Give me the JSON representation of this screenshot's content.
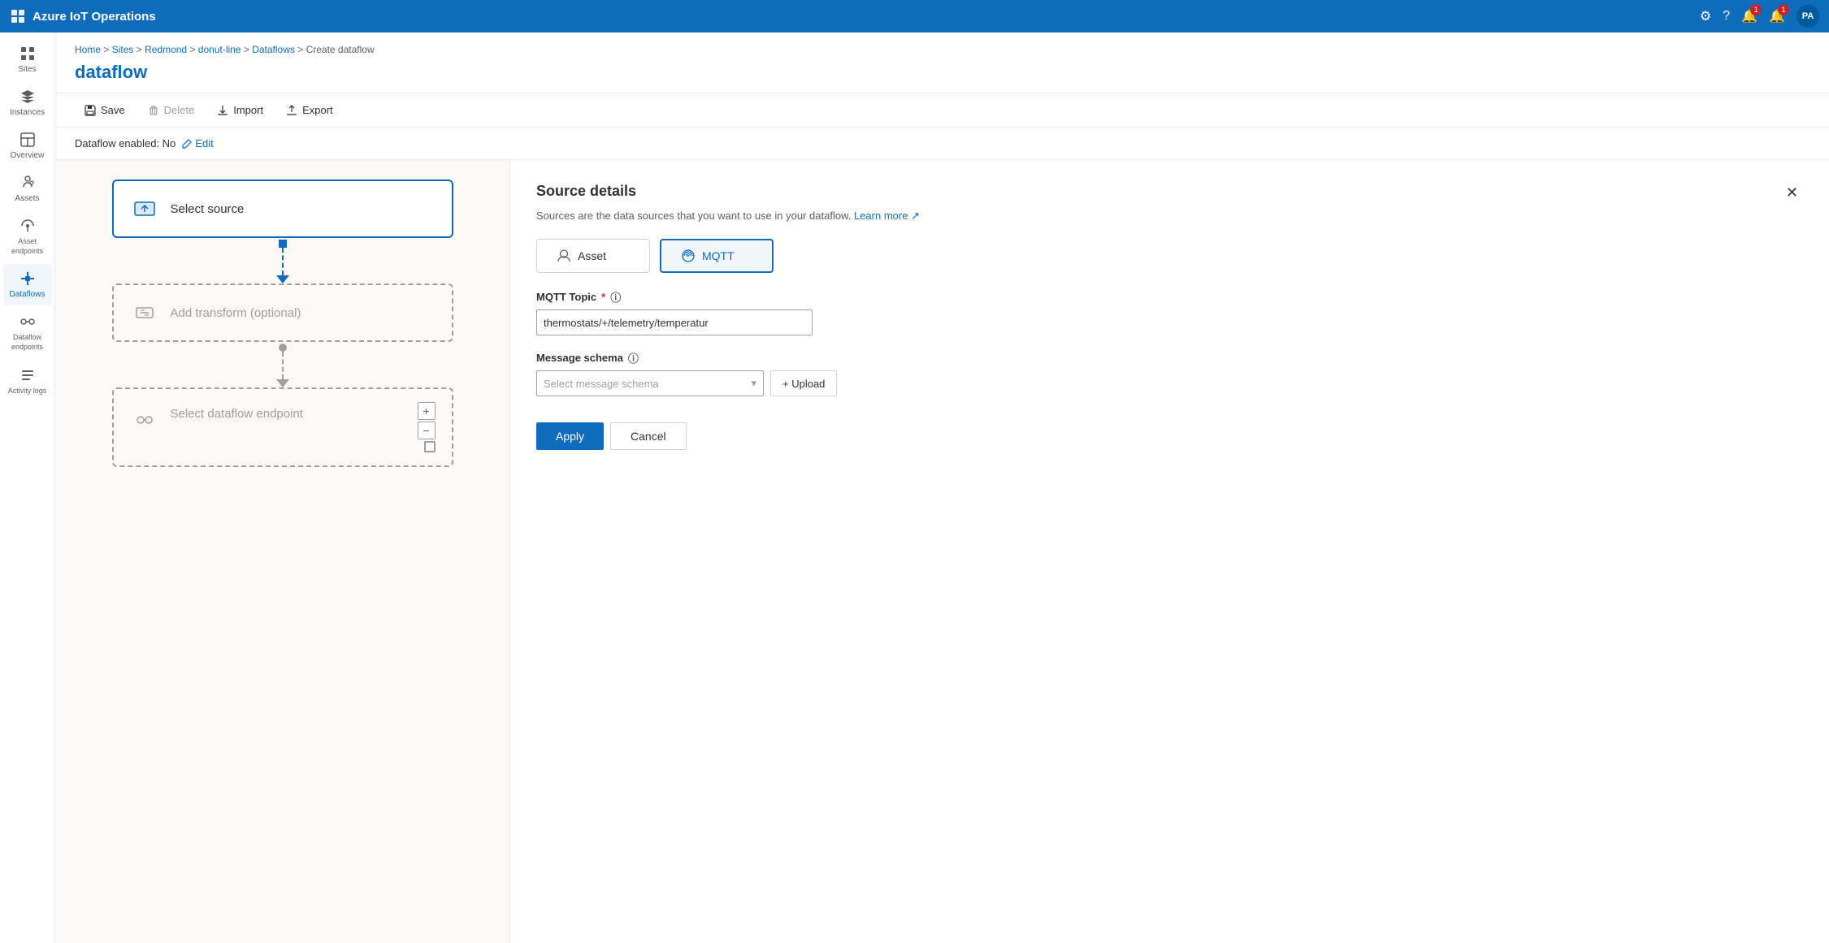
{
  "app": {
    "title": "Azure IoT Operations"
  },
  "topbar": {
    "title": "Azure IoT Operations",
    "user_initials": "PA"
  },
  "breadcrumb": {
    "items": [
      "Home",
      "Sites",
      "Redmond",
      "donut-line",
      "Dataflows",
      "Create dataflow"
    ]
  },
  "page": {
    "title": "dataflow"
  },
  "toolbar": {
    "save": "Save",
    "delete": "Delete",
    "import": "Import",
    "export": "Export"
  },
  "status": {
    "label": "Dataflow enabled: No",
    "edit": "Edit"
  },
  "canvas": {
    "select_source_label": "Select source",
    "add_transform_label": "Add transform (optional)",
    "select_endpoint_label": "Select dataflow endpoint"
  },
  "details_panel": {
    "title": "Source details",
    "description": "Sources are the data sources that you want to use in your dataflow.",
    "learn_more": "Learn more",
    "asset_btn": "Asset",
    "mqtt_btn": "MQTT",
    "mqtt_topic_label": "MQTT Topic",
    "mqtt_topic_required": "*",
    "mqtt_topic_value": "thermostats/+/telemetry/temperatur",
    "message_schema_label": "Message schema",
    "message_schema_placeholder": "Select message schema",
    "upload_btn": "+ Upload",
    "apply_btn": "Apply",
    "cancel_btn": "Cancel"
  },
  "sidebar": {
    "items": [
      {
        "label": "Sites",
        "icon": "grid"
      },
      {
        "label": "Instances",
        "icon": "layers"
      },
      {
        "label": "Overview",
        "icon": "view"
      },
      {
        "label": "Assets",
        "icon": "asset"
      },
      {
        "label": "Asset endpoints",
        "icon": "endpoint"
      },
      {
        "label": "Dataflows",
        "icon": "dataflow",
        "active": true
      },
      {
        "label": "Dataflow endpoints",
        "icon": "df-endpoint"
      },
      {
        "label": "Activity logs",
        "icon": "log"
      }
    ]
  }
}
